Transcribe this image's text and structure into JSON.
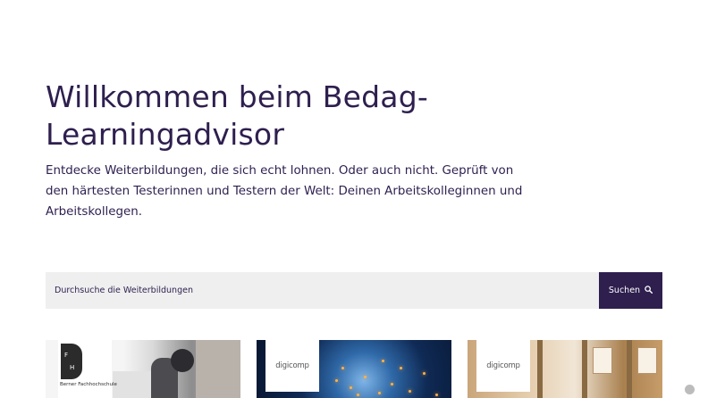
{
  "hero": {
    "title": "Willkommen beim Bedag-Learningadvisor",
    "subtitle": "Entdecke Weiterbildungen, die sich echt lohnen. Oder auch nicht. Geprüft von den härtesten Testerinnen und Testern der Welt: Deinen Arbeitskolleginnen und Arbeitskollegen."
  },
  "search": {
    "placeholder": "Durchsuche die Weiterbildungen",
    "value": "",
    "button_label": "Suchen",
    "button_icon": "search-icon"
  },
  "cards": [
    {
      "provider_logo": "fh-logo",
      "logo_letters": [
        "F",
        "H"
      ],
      "logo_text": "Berner Fachhochschule"
    },
    {
      "provider_logo": "digicomp-logo",
      "logo_text": "digicomp"
    },
    {
      "provider_logo": "digicomp-logo",
      "logo_text": "digicomp"
    }
  ],
  "colors": {
    "accent": "#2e1f4f",
    "search_bg": "#efefef",
    "background": "#ffffff"
  }
}
